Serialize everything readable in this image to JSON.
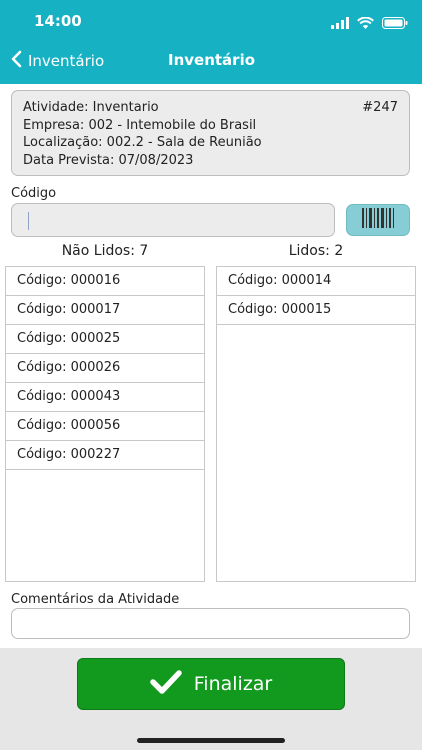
{
  "status_bar": {
    "time": "14:00"
  },
  "nav": {
    "back_label": "Inventário",
    "title": "Inventário"
  },
  "activity": {
    "atividade": "Atividade: Inventario",
    "number": "#247",
    "empresa": "Empresa: 002 - Intemobile do Brasil",
    "localizacao": "Localização: 002.2 - Sala de Reunião",
    "data_prevista": "Data Prevista: 07/08/2023"
  },
  "codigo": {
    "label": "Código",
    "value": ""
  },
  "nao_lidos": {
    "heading": "Não Lidos: 7",
    "items": [
      "Código: 000016",
      "Código: 000017",
      "Código: 000025",
      "Código: 000026",
      "Código: 000043",
      "Código: 000056",
      "Código: 000227"
    ]
  },
  "lidos": {
    "heading": "Lidos: 2",
    "items": [
      "Código: 000014",
      "Código: 000015"
    ]
  },
  "comentarios": {
    "label": "Comentários da Atividade",
    "value": ""
  },
  "footer": {
    "finalizar_label": "Finalizar"
  },
  "colors": {
    "accent": "#17b1c4",
    "primary_button": "#129a1f",
    "scan_button": "#86cdd5"
  },
  "icons": {
    "back": "chevron-left-icon",
    "scan": "barcode-icon",
    "confirm": "checkmark-icon"
  }
}
